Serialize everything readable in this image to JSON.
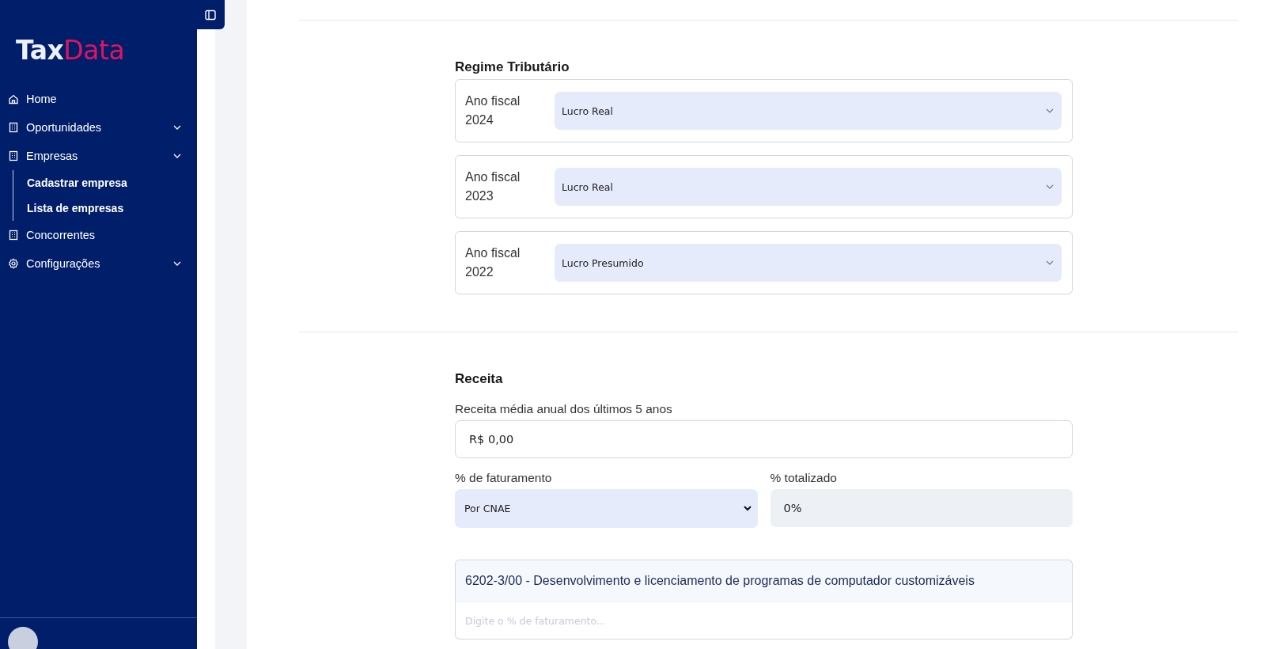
{
  "sidebar": {
    "logo": {
      "part_1": "Tax",
      "part_2": "Data"
    },
    "items": [
      {
        "label": "Home",
        "expandable": false
      },
      {
        "label": "Oportunidades",
        "expandable": true
      },
      {
        "label": "Empresas",
        "expandable": true,
        "children": [
          {
            "label": "Cadastrar empresa"
          },
          {
            "label": "Lista de empresas"
          }
        ]
      },
      {
        "label": "Concorrentes",
        "expandable": false
      },
      {
        "label": "Configurações",
        "expandable": true
      }
    ]
  },
  "regime": {
    "title": "Regime Tributário",
    "rows": [
      {
        "label": "Ano fiscal 2024",
        "value": "Lucro Real"
      },
      {
        "label": "Ano fiscal 2023",
        "value": "Lucro Real"
      },
      {
        "label": "Ano fiscal 2022",
        "value": "Lucro Presumido"
      }
    ]
  },
  "receita": {
    "title": "Receita",
    "average_label": "Receita média anual dos últimos 5 anos",
    "average_value": "R$ 0,00",
    "billing_label": "% de faturamento",
    "billing_value": "Por CNAE",
    "total_label": "% totalizado",
    "total_value": "0%",
    "total_disabled": true,
    "cnae": {
      "title": "6202-3/00 - Desenvolvimento e licenciamento de programas de computador customizáveis",
      "placeholder": "Digite o % de faturamento..."
    }
  }
}
